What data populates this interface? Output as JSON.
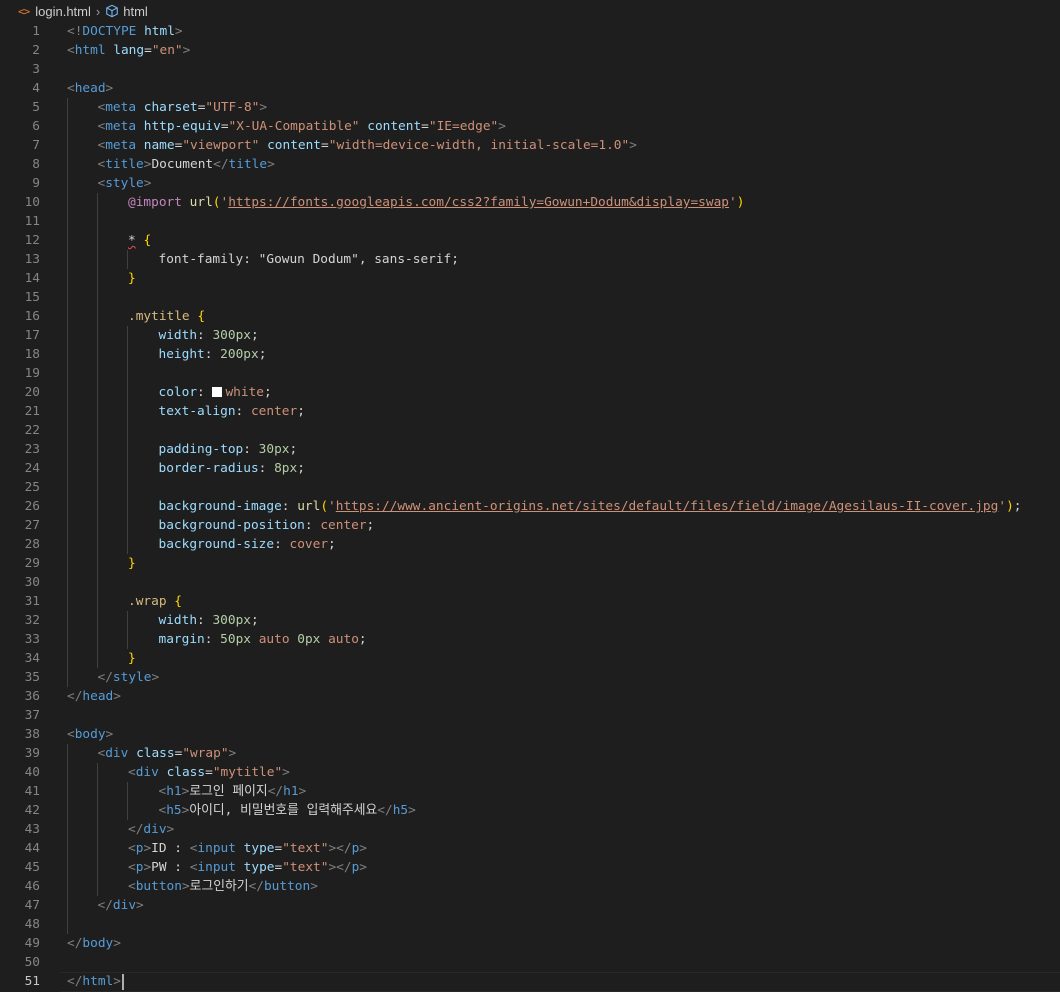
{
  "breadcrumb": {
    "file": "login.html",
    "symbol": "html"
  },
  "editor": {
    "current_line": 51,
    "lines": [
      {
        "indent": 0,
        "tokens": [
          [
            "pu",
            "<!"
          ],
          [
            "tg",
            "DOCTYPE"
          ],
          [
            "tx",
            " "
          ],
          [
            "at",
            "html"
          ],
          [
            "pu",
            ">"
          ]
        ]
      },
      {
        "indent": 0,
        "tokens": [
          [
            "pu",
            "<"
          ],
          [
            "tg",
            "html"
          ],
          [
            "tx",
            " "
          ],
          [
            "at",
            "lang"
          ],
          [
            "tx",
            "="
          ],
          [
            "st",
            "\"en\""
          ],
          [
            "pu",
            ">"
          ]
        ]
      },
      {
        "indent": 0,
        "tokens": []
      },
      {
        "indent": 0,
        "tokens": [
          [
            "pu",
            "<"
          ],
          [
            "tg",
            "head"
          ],
          [
            "pu",
            ">"
          ]
        ]
      },
      {
        "indent": 1,
        "tokens": [
          [
            "pu",
            "<"
          ],
          [
            "tg",
            "meta"
          ],
          [
            "tx",
            " "
          ],
          [
            "at",
            "charset"
          ],
          [
            "tx",
            "="
          ],
          [
            "st",
            "\"UTF-8\""
          ],
          [
            "pu",
            ">"
          ]
        ]
      },
      {
        "indent": 1,
        "tokens": [
          [
            "pu",
            "<"
          ],
          [
            "tg",
            "meta"
          ],
          [
            "tx",
            " "
          ],
          [
            "at",
            "http-equiv"
          ],
          [
            "tx",
            "="
          ],
          [
            "st",
            "\"X-UA-Compatible\""
          ],
          [
            "tx",
            " "
          ],
          [
            "at",
            "content"
          ],
          [
            "tx",
            "="
          ],
          [
            "st",
            "\"IE=edge\""
          ],
          [
            "pu",
            ">"
          ]
        ]
      },
      {
        "indent": 1,
        "tokens": [
          [
            "pu",
            "<"
          ],
          [
            "tg",
            "meta"
          ],
          [
            "tx",
            " "
          ],
          [
            "at",
            "name"
          ],
          [
            "tx",
            "="
          ],
          [
            "st",
            "\"viewport\""
          ],
          [
            "tx",
            " "
          ],
          [
            "at",
            "content"
          ],
          [
            "tx",
            "="
          ],
          [
            "st",
            "\"width=device-width, initial-scale=1.0\""
          ],
          [
            "pu",
            ">"
          ]
        ]
      },
      {
        "indent": 1,
        "tokens": [
          [
            "pu",
            "<"
          ],
          [
            "tg",
            "title"
          ],
          [
            "pu",
            ">"
          ],
          [
            "tx",
            "Document"
          ],
          [
            "pu",
            "</"
          ],
          [
            "tg",
            "title"
          ],
          [
            "pu",
            ">"
          ]
        ]
      },
      {
        "indent": 1,
        "tokens": [
          [
            "pu",
            "<"
          ],
          [
            "tg",
            "style"
          ],
          [
            "pu",
            ">"
          ]
        ]
      },
      {
        "indent": 2,
        "tokens": [
          [
            "kw",
            "@import"
          ],
          [
            "tx",
            " "
          ],
          [
            "fn",
            "url"
          ],
          [
            "br",
            "("
          ],
          [
            "st",
            "'"
          ],
          [
            "ul",
            "https://fonts.googleapis.com/css2?family=Gowun+Dodum&display=swap"
          ],
          [
            "st",
            "'"
          ],
          [
            "br",
            ")"
          ]
        ]
      },
      {
        "indent": 2,
        "tokens": []
      },
      {
        "indent": 2,
        "tokens": [
          [
            "sq",
            "*"
          ],
          [
            "tx",
            " "
          ],
          [
            "br",
            "{"
          ]
        ]
      },
      {
        "indent": 3,
        "tokens": [
          [
            "tx",
            "font-family: \"Gowun Dodum\", sans-serif;"
          ]
        ]
      },
      {
        "indent": 2,
        "tokens": [
          [
            "br",
            "}"
          ]
        ]
      },
      {
        "indent": 2,
        "tokens": []
      },
      {
        "indent": 2,
        "tokens": [
          [
            "sl",
            ".mytitle"
          ],
          [
            "tx",
            " "
          ],
          [
            "br",
            "{"
          ]
        ]
      },
      {
        "indent": 3,
        "tokens": [
          [
            "pr",
            "width"
          ],
          [
            "tx",
            ": "
          ],
          [
            "nu",
            "300px"
          ],
          [
            "tx",
            ";"
          ]
        ]
      },
      {
        "indent": 3,
        "tokens": [
          [
            "pr",
            "height"
          ],
          [
            "tx",
            ": "
          ],
          [
            "nu",
            "200px"
          ],
          [
            "tx",
            ";"
          ]
        ]
      },
      {
        "indent": 3,
        "tokens": []
      },
      {
        "indent": 3,
        "tokens": [
          [
            "pr",
            "color"
          ],
          [
            "tx",
            ": "
          ],
          [
            "sw",
            ""
          ],
          [
            "st",
            "white"
          ],
          [
            "tx",
            ";"
          ]
        ]
      },
      {
        "indent": 3,
        "tokens": [
          [
            "pr",
            "text-align"
          ],
          [
            "tx",
            ": "
          ],
          [
            "st",
            "center"
          ],
          [
            "tx",
            ";"
          ]
        ]
      },
      {
        "indent": 3,
        "tokens": []
      },
      {
        "indent": 3,
        "tokens": [
          [
            "pr",
            "padding-top"
          ],
          [
            "tx",
            ": "
          ],
          [
            "nu",
            "30px"
          ],
          [
            "tx",
            ";"
          ]
        ]
      },
      {
        "indent": 3,
        "tokens": [
          [
            "pr",
            "border-radius"
          ],
          [
            "tx",
            ": "
          ],
          [
            "nu",
            "8px"
          ],
          [
            "tx",
            ";"
          ]
        ]
      },
      {
        "indent": 3,
        "tokens": []
      },
      {
        "indent": 3,
        "tokens": [
          [
            "pr",
            "background-image"
          ],
          [
            "tx",
            ": "
          ],
          [
            "fn",
            "url"
          ],
          [
            "br",
            "("
          ],
          [
            "st",
            "'"
          ],
          [
            "ul",
            "https://www.ancient-origins.net/sites/default/files/field/image/Agesilaus-II-cover.jpg"
          ],
          [
            "st",
            "'"
          ],
          [
            "br",
            ")"
          ],
          [
            "tx",
            ";"
          ]
        ]
      },
      {
        "indent": 3,
        "tokens": [
          [
            "pr",
            "background-position"
          ],
          [
            "tx",
            ": "
          ],
          [
            "st",
            "center"
          ],
          [
            "tx",
            ";"
          ]
        ]
      },
      {
        "indent": 3,
        "tokens": [
          [
            "pr",
            "background-size"
          ],
          [
            "tx",
            ": "
          ],
          [
            "st",
            "cover"
          ],
          [
            "tx",
            ";"
          ]
        ]
      },
      {
        "indent": 2,
        "tokens": [
          [
            "br",
            "}"
          ]
        ]
      },
      {
        "indent": 2,
        "tokens": []
      },
      {
        "indent": 2,
        "tokens": [
          [
            "sl",
            ".wrap"
          ],
          [
            "tx",
            " "
          ],
          [
            "br",
            "{"
          ]
        ]
      },
      {
        "indent": 3,
        "tokens": [
          [
            "pr",
            "width"
          ],
          [
            "tx",
            ": "
          ],
          [
            "nu",
            "300px"
          ],
          [
            "tx",
            ";"
          ]
        ]
      },
      {
        "indent": 3,
        "tokens": [
          [
            "pr",
            "margin"
          ],
          [
            "tx",
            ": "
          ],
          [
            "nu",
            "50px"
          ],
          [
            "tx",
            " "
          ],
          [
            "st",
            "auto"
          ],
          [
            "tx",
            " "
          ],
          [
            "nu",
            "0px"
          ],
          [
            "tx",
            " "
          ],
          [
            "st",
            "auto"
          ],
          [
            "tx",
            ";"
          ]
        ]
      },
      {
        "indent": 2,
        "tokens": [
          [
            "br",
            "}"
          ]
        ]
      },
      {
        "indent": 1,
        "tokens": [
          [
            "pu",
            "</"
          ],
          [
            "tg",
            "style"
          ],
          [
            "pu",
            ">"
          ]
        ]
      },
      {
        "indent": 0,
        "tokens": [
          [
            "pu",
            "</"
          ],
          [
            "tg",
            "head"
          ],
          [
            "pu",
            ">"
          ]
        ]
      },
      {
        "indent": 0,
        "tokens": []
      },
      {
        "indent": 0,
        "tokens": [
          [
            "pu",
            "<"
          ],
          [
            "tg",
            "body"
          ],
          [
            "pu",
            ">"
          ]
        ]
      },
      {
        "indent": 1,
        "tokens": [
          [
            "pu",
            "<"
          ],
          [
            "tg",
            "div"
          ],
          [
            "tx",
            " "
          ],
          [
            "at",
            "class"
          ],
          [
            "tx",
            "="
          ],
          [
            "st",
            "\"wrap\""
          ],
          [
            "pu",
            ">"
          ]
        ]
      },
      {
        "indent": 2,
        "tokens": [
          [
            "pu",
            "<"
          ],
          [
            "tg",
            "div"
          ],
          [
            "tx",
            " "
          ],
          [
            "at",
            "class"
          ],
          [
            "tx",
            "="
          ],
          [
            "st",
            "\"mytitle\""
          ],
          [
            "pu",
            ">"
          ]
        ]
      },
      {
        "indent": 3,
        "tokens": [
          [
            "pu",
            "<"
          ],
          [
            "tg",
            "h1"
          ],
          [
            "pu",
            ">"
          ],
          [
            "tx",
            "로그인 페이지"
          ],
          [
            "pu",
            "</"
          ],
          [
            "tg",
            "h1"
          ],
          [
            "pu",
            ">"
          ]
        ]
      },
      {
        "indent": 3,
        "tokens": [
          [
            "pu",
            "<"
          ],
          [
            "tg",
            "h5"
          ],
          [
            "pu",
            ">"
          ],
          [
            "tx",
            "아이디, 비밀번호를 입력해주세요"
          ],
          [
            "pu",
            "</"
          ],
          [
            "tg",
            "h5"
          ],
          [
            "pu",
            ">"
          ]
        ]
      },
      {
        "indent": 2,
        "tokens": [
          [
            "pu",
            "</"
          ],
          [
            "tg",
            "div"
          ],
          [
            "pu",
            ">"
          ]
        ]
      },
      {
        "indent": 2,
        "tokens": [
          [
            "pu",
            "<"
          ],
          [
            "tg",
            "p"
          ],
          [
            "pu",
            ">"
          ],
          [
            "tx",
            "ID : "
          ],
          [
            "pu",
            "<"
          ],
          [
            "tg",
            "input"
          ],
          [
            "tx",
            " "
          ],
          [
            "at",
            "type"
          ],
          [
            "tx",
            "="
          ],
          [
            "st",
            "\"text\""
          ],
          [
            "pu",
            "></"
          ],
          [
            "tg",
            "p"
          ],
          [
            "pu",
            ">"
          ]
        ]
      },
      {
        "indent": 2,
        "tokens": [
          [
            "pu",
            "<"
          ],
          [
            "tg",
            "p"
          ],
          [
            "pu",
            ">"
          ],
          [
            "tx",
            "PW : "
          ],
          [
            "pu",
            "<"
          ],
          [
            "tg",
            "input"
          ],
          [
            "tx",
            " "
          ],
          [
            "at",
            "type"
          ],
          [
            "tx",
            "="
          ],
          [
            "st",
            "\"text\""
          ],
          [
            "pu",
            "></"
          ],
          [
            "tg",
            "p"
          ],
          [
            "pu",
            ">"
          ]
        ]
      },
      {
        "indent": 2,
        "tokens": [
          [
            "pu",
            "<"
          ],
          [
            "tg",
            "button"
          ],
          [
            "pu",
            ">"
          ],
          [
            "tx",
            "로그인하기"
          ],
          [
            "pu",
            "</"
          ],
          [
            "tg",
            "button"
          ],
          [
            "pu",
            ">"
          ]
        ]
      },
      {
        "indent": 1,
        "tokens": [
          [
            "pu",
            "</"
          ],
          [
            "tg",
            "div"
          ],
          [
            "pu",
            ">"
          ]
        ]
      },
      {
        "indent": 1,
        "tokens": []
      },
      {
        "indent": 0,
        "tokens": [
          [
            "pu",
            "</"
          ],
          [
            "tg",
            "body"
          ],
          [
            "pu",
            ">"
          ]
        ]
      },
      {
        "indent": 0,
        "tokens": []
      },
      {
        "indent": 0,
        "tokens": [
          [
            "pu",
            "</"
          ],
          [
            "tg",
            "html"
          ],
          [
            "pu",
            ">"
          ]
        ]
      }
    ]
  }
}
